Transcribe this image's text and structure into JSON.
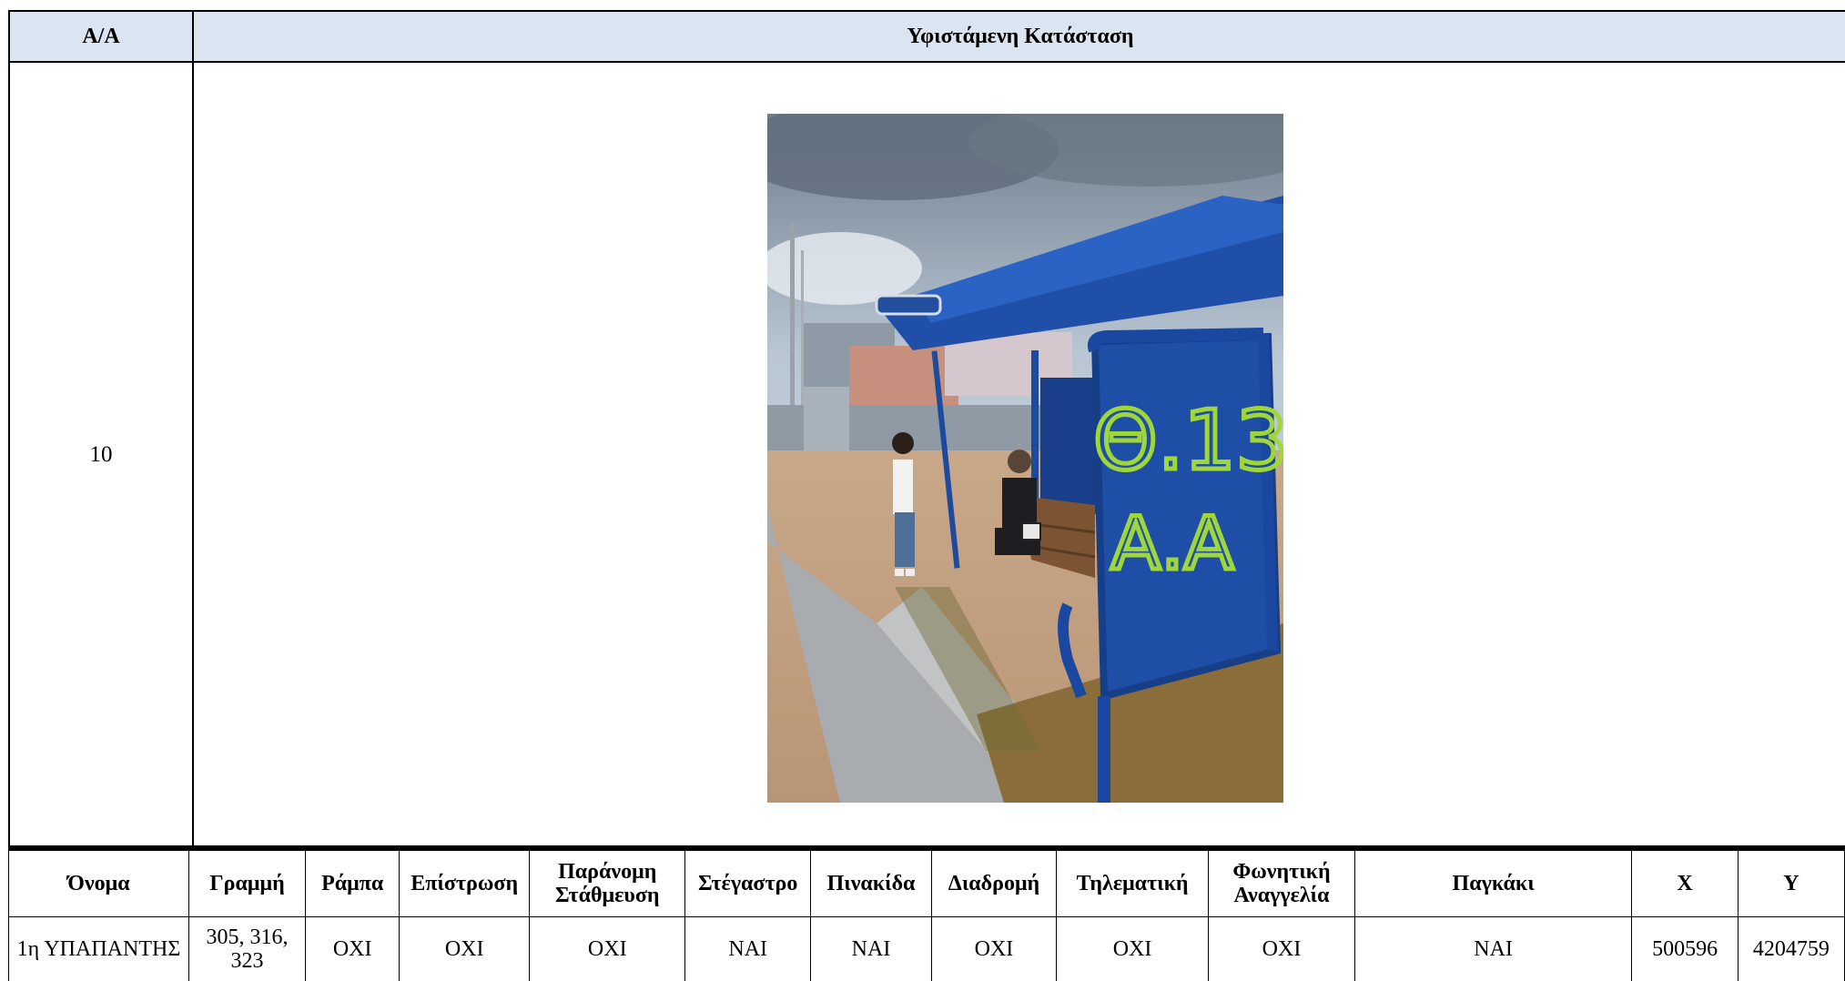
{
  "header": {
    "aa_label": "Α/Α",
    "state_label": "Υφιστάμενη Κατάσταση"
  },
  "entry": {
    "number": "10",
    "photo": {
      "description_icon": "bus-stop-photo",
      "graffiti_line1": "Θ.13",
      "graffiti_line2": "Α.Α"
    }
  },
  "attributes": {
    "columns": [
      "Όνομα",
      "Γραμμή",
      "Ράμπα",
      "Επίστρωση",
      "Παράνομη Στάθμευση",
      "Στέγαστρο",
      "Πινακίδα",
      "Διαδρομή",
      "Τηλεματική",
      "Φωνητική Αναγγελία",
      "Παγκάκι",
      "X",
      "Y"
    ],
    "row": [
      "1η ΥΠΑΠΑΝΤΗΣ",
      "305, 316, 323",
      "ΟΧΙ",
      "ΟΧΙ",
      "ΟΧΙ",
      "ΝΑΙ",
      "ΝΑΙ",
      "ΟΧΙ",
      "ΟΧΙ",
      "ΟΧΙ",
      "ΝΑΙ",
      "500596",
      "4204759"
    ]
  },
  "colors": {
    "header_bg": "#dbe5f1",
    "shelter_blue": "#1f4fa8",
    "graffiti_green": "#9fd63a"
  }
}
